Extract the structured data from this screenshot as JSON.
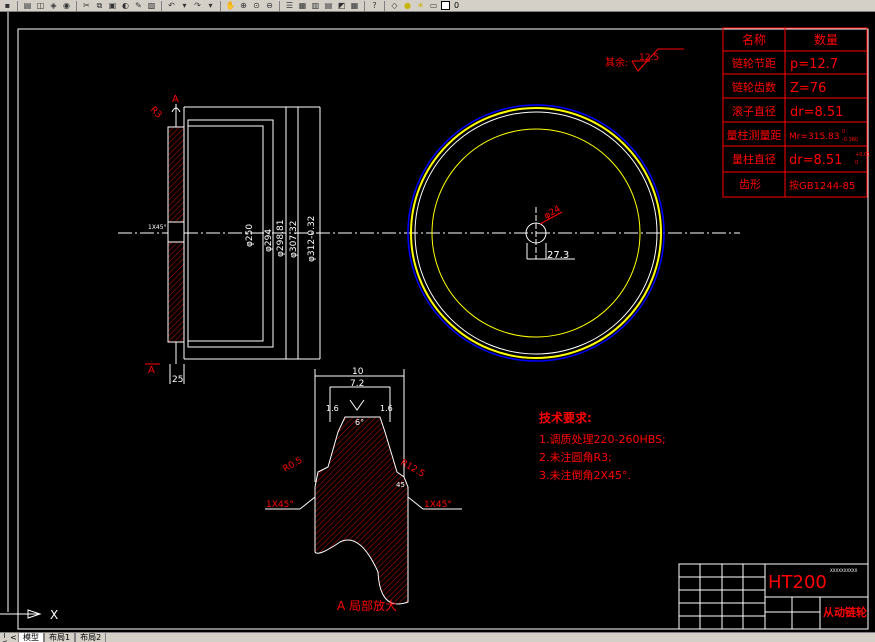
{
  "toolbar": {
    "icons": [
      "save-icon",
      "print-icon",
      "preview-icon",
      "publish-icon",
      "plot-icon",
      "cut-icon",
      "copy-icon",
      "paste-icon",
      "match-icon",
      "brush-icon",
      "undo-icon",
      "redo-icon",
      "pan-icon",
      "zoom-realtime-icon",
      "zoom-window-icon",
      "zoom-previous-icon",
      "properties-icon",
      "design-center-icon",
      "tool-palette-icon",
      "sheet-set-icon",
      "markup-icon",
      "calculator-icon",
      "help-icon",
      "layer-icon",
      "bulb-icon",
      "sun-icon",
      "lock-icon",
      "color-icon"
    ],
    "layer_name": "0"
  },
  "tabs": {
    "items": [
      "模型",
      "布局1",
      "布局2"
    ]
  },
  "params_table": {
    "header": [
      "名称",
      "数量"
    ],
    "rows": [
      [
        "链轮节距",
        "p=12.7"
      ],
      [
        "链轮齿数",
        "Z=76"
      ],
      [
        "滚子直径",
        "dr=8.51"
      ],
      [
        "量柱测量距",
        "Mr=315.83"
      ],
      [
        "量柱直径",
        "dr=8.51"
      ],
      [
        "齿形",
        "按GB1244-85"
      ]
    ],
    "tol_upper": "0",
    "tol_lower": "-0.360",
    "tol_upper2": "+0.01",
    "tol_lower2": "0"
  },
  "roughness": {
    "label": "其余:",
    "value": "12.5"
  },
  "section_view": {
    "top_label": "A",
    "bottom_label": "A",
    "radius": "R3",
    "chamfer": "1X45°",
    "width_dim": "25",
    "diameters": [
      "φ250",
      "φ294",
      "φ298.81",
      "φ307.32",
      "φ312-0.32"
    ]
  },
  "front_view": {
    "hole_dia": "φ24",
    "key_dim": "27.3"
  },
  "detail_view": {
    "title": "A 局部放大",
    "width": "10",
    "width2": "7.2",
    "fillet_left": "1.6",
    "fillet_right": "1.6",
    "angle": "6°",
    "r_left": "R0.5",
    "r_right": "R12.5",
    "chamfer_left": "1X45°",
    "chamfer_right": "1X45°",
    "small": "45"
  },
  "tech_requirements": {
    "title": "技术要求:",
    "items": [
      "1.调质处理220-260HBS;",
      "2.未注圆角R3;",
      "3.未注倒角2X45°."
    ]
  },
  "title_block": {
    "material": "HT200",
    "part_name": "从动链轮",
    "small_text": "XXXXXXXXXX"
  },
  "colors": {
    "red": "#ff0000",
    "white": "#ffffff",
    "yellow": "#ffff00",
    "blue": "#0000ff",
    "cyan": "#00ffff"
  }
}
